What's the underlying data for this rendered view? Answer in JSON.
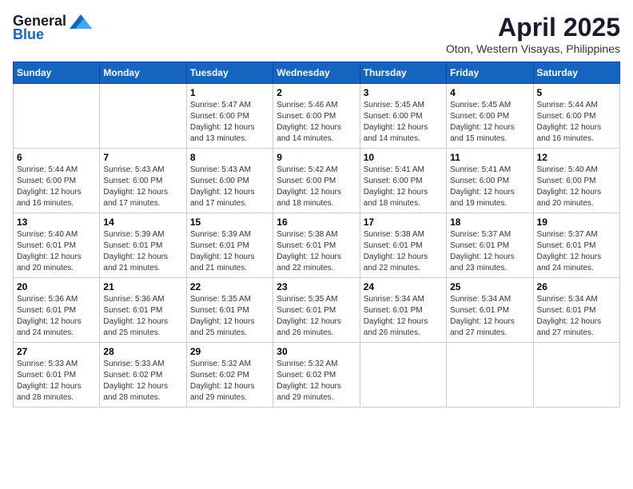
{
  "logo": {
    "general": "General",
    "blue": "Blue"
  },
  "title": {
    "month": "April 2025",
    "location": "Oton, Western Visayas, Philippines"
  },
  "headers": [
    "Sunday",
    "Monday",
    "Tuesday",
    "Wednesday",
    "Thursday",
    "Friday",
    "Saturday"
  ],
  "weeks": [
    [
      {
        "day": "",
        "info": ""
      },
      {
        "day": "",
        "info": ""
      },
      {
        "day": "1",
        "info": "Sunrise: 5:47 AM\nSunset: 6:00 PM\nDaylight: 12 hours and 13 minutes."
      },
      {
        "day": "2",
        "info": "Sunrise: 5:46 AM\nSunset: 6:00 PM\nDaylight: 12 hours and 14 minutes."
      },
      {
        "day": "3",
        "info": "Sunrise: 5:45 AM\nSunset: 6:00 PM\nDaylight: 12 hours and 14 minutes."
      },
      {
        "day": "4",
        "info": "Sunrise: 5:45 AM\nSunset: 6:00 PM\nDaylight: 12 hours and 15 minutes."
      },
      {
        "day": "5",
        "info": "Sunrise: 5:44 AM\nSunset: 6:00 PM\nDaylight: 12 hours and 16 minutes."
      }
    ],
    [
      {
        "day": "6",
        "info": "Sunrise: 5:44 AM\nSunset: 6:00 PM\nDaylight: 12 hours and 16 minutes."
      },
      {
        "day": "7",
        "info": "Sunrise: 5:43 AM\nSunset: 6:00 PM\nDaylight: 12 hours and 17 minutes."
      },
      {
        "day": "8",
        "info": "Sunrise: 5:43 AM\nSunset: 6:00 PM\nDaylight: 12 hours and 17 minutes."
      },
      {
        "day": "9",
        "info": "Sunrise: 5:42 AM\nSunset: 6:00 PM\nDaylight: 12 hours and 18 minutes."
      },
      {
        "day": "10",
        "info": "Sunrise: 5:41 AM\nSunset: 6:00 PM\nDaylight: 12 hours and 18 minutes."
      },
      {
        "day": "11",
        "info": "Sunrise: 5:41 AM\nSunset: 6:00 PM\nDaylight: 12 hours and 19 minutes."
      },
      {
        "day": "12",
        "info": "Sunrise: 5:40 AM\nSunset: 6:00 PM\nDaylight: 12 hours and 20 minutes."
      }
    ],
    [
      {
        "day": "13",
        "info": "Sunrise: 5:40 AM\nSunset: 6:01 PM\nDaylight: 12 hours and 20 minutes."
      },
      {
        "day": "14",
        "info": "Sunrise: 5:39 AM\nSunset: 6:01 PM\nDaylight: 12 hours and 21 minutes."
      },
      {
        "day": "15",
        "info": "Sunrise: 5:39 AM\nSunset: 6:01 PM\nDaylight: 12 hours and 21 minutes."
      },
      {
        "day": "16",
        "info": "Sunrise: 5:38 AM\nSunset: 6:01 PM\nDaylight: 12 hours and 22 minutes."
      },
      {
        "day": "17",
        "info": "Sunrise: 5:38 AM\nSunset: 6:01 PM\nDaylight: 12 hours and 22 minutes."
      },
      {
        "day": "18",
        "info": "Sunrise: 5:37 AM\nSunset: 6:01 PM\nDaylight: 12 hours and 23 minutes."
      },
      {
        "day": "19",
        "info": "Sunrise: 5:37 AM\nSunset: 6:01 PM\nDaylight: 12 hours and 24 minutes."
      }
    ],
    [
      {
        "day": "20",
        "info": "Sunrise: 5:36 AM\nSunset: 6:01 PM\nDaylight: 12 hours and 24 minutes."
      },
      {
        "day": "21",
        "info": "Sunrise: 5:36 AM\nSunset: 6:01 PM\nDaylight: 12 hours and 25 minutes."
      },
      {
        "day": "22",
        "info": "Sunrise: 5:35 AM\nSunset: 6:01 PM\nDaylight: 12 hours and 25 minutes."
      },
      {
        "day": "23",
        "info": "Sunrise: 5:35 AM\nSunset: 6:01 PM\nDaylight: 12 hours and 26 minutes."
      },
      {
        "day": "24",
        "info": "Sunrise: 5:34 AM\nSunset: 6:01 PM\nDaylight: 12 hours and 26 minutes."
      },
      {
        "day": "25",
        "info": "Sunrise: 5:34 AM\nSunset: 6:01 PM\nDaylight: 12 hours and 27 minutes."
      },
      {
        "day": "26",
        "info": "Sunrise: 5:34 AM\nSunset: 6:01 PM\nDaylight: 12 hours and 27 minutes."
      }
    ],
    [
      {
        "day": "27",
        "info": "Sunrise: 5:33 AM\nSunset: 6:01 PM\nDaylight: 12 hours and 28 minutes."
      },
      {
        "day": "28",
        "info": "Sunrise: 5:33 AM\nSunset: 6:02 PM\nDaylight: 12 hours and 28 minutes."
      },
      {
        "day": "29",
        "info": "Sunrise: 5:32 AM\nSunset: 6:02 PM\nDaylight: 12 hours and 29 minutes."
      },
      {
        "day": "30",
        "info": "Sunrise: 5:32 AM\nSunset: 6:02 PM\nDaylight: 12 hours and 29 minutes."
      },
      {
        "day": "",
        "info": ""
      },
      {
        "day": "",
        "info": ""
      },
      {
        "day": "",
        "info": ""
      }
    ]
  ]
}
